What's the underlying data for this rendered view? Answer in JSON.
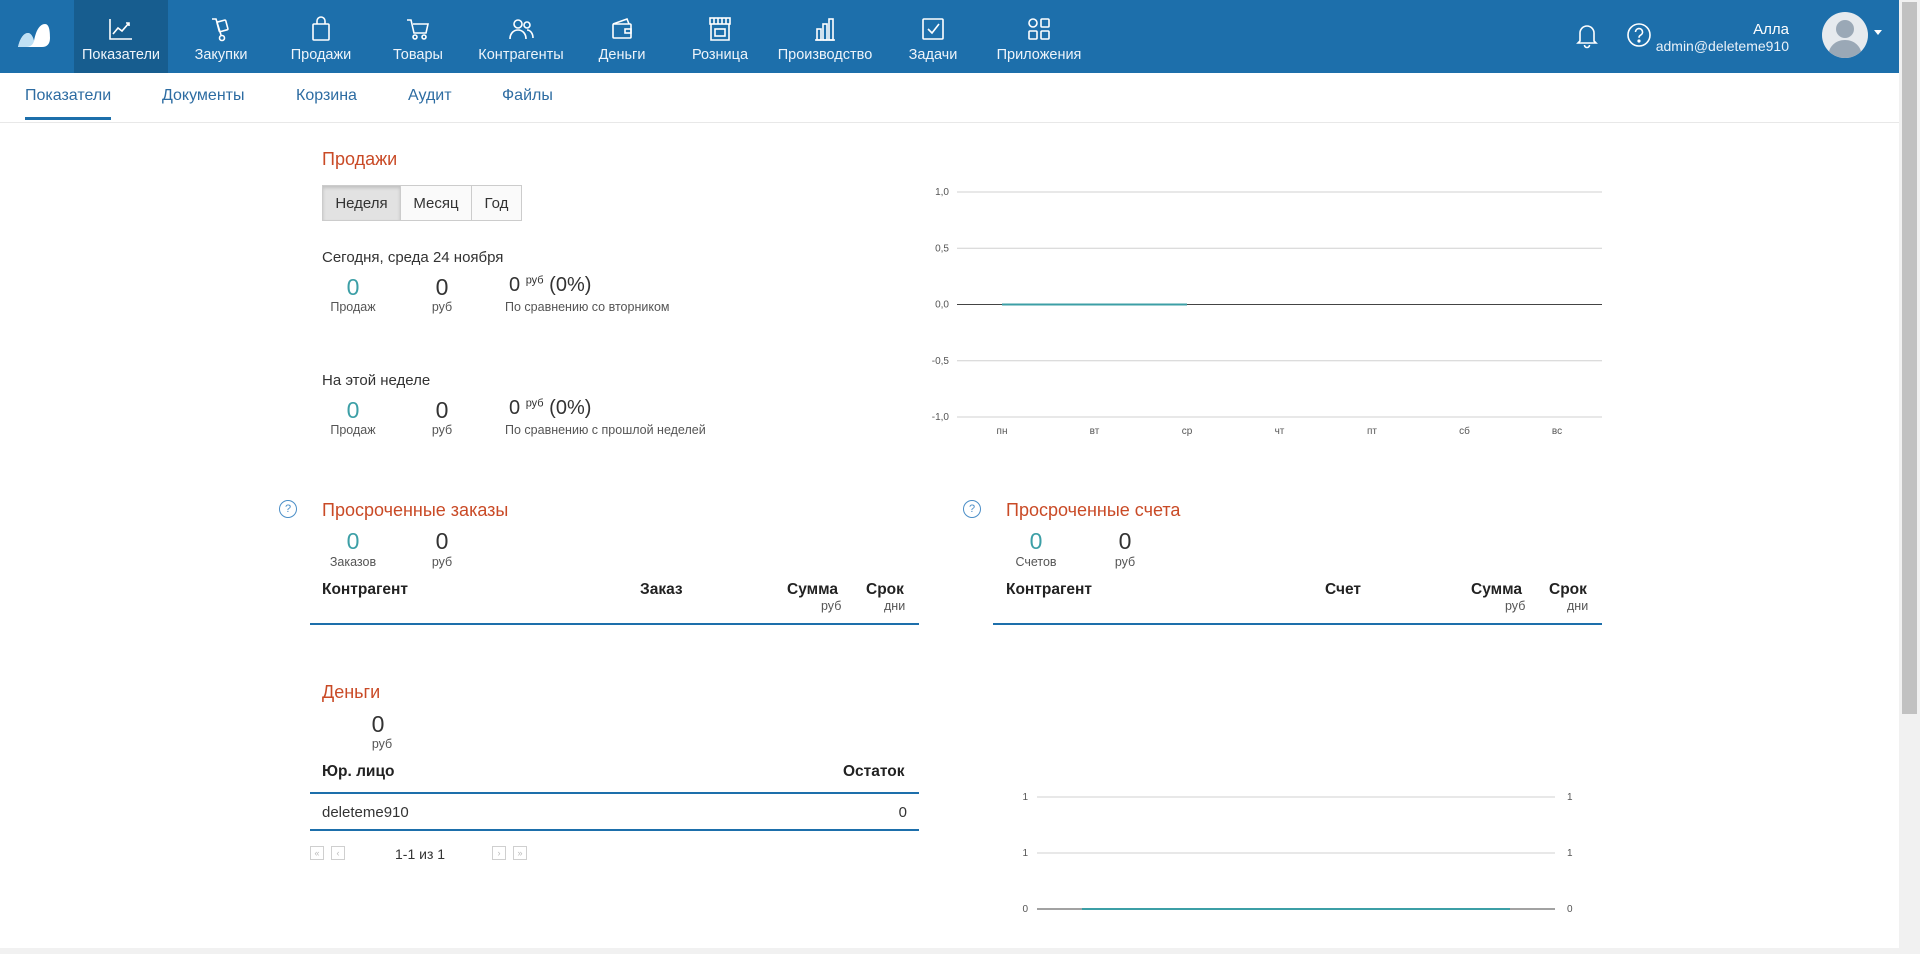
{
  "colors": {
    "nav_bg": "#1d6fab",
    "accent_title": "#c94a26",
    "teal": "#3c9fa6"
  },
  "topnav": {
    "items": [
      {
        "label": "Показатели",
        "icon": "chart-line-icon",
        "active": true
      },
      {
        "label": "Закупки",
        "icon": "hand-truck-icon"
      },
      {
        "label": "Продажи",
        "icon": "shopping-bag-icon"
      },
      {
        "label": "Товары",
        "icon": "cart-icon"
      },
      {
        "label": "Контрагенты",
        "icon": "users-icon"
      },
      {
        "label": "Деньги",
        "icon": "wallet-icon"
      },
      {
        "label": "Розница",
        "icon": "store-icon"
      },
      {
        "label": "Производство",
        "icon": "factory-icon"
      },
      {
        "label": "Задачи",
        "icon": "checkbox-icon"
      },
      {
        "label": "Приложения",
        "icon": "apps-grid-icon"
      }
    ],
    "user": {
      "name": "Алла",
      "email": "admin@deleteme910"
    }
  },
  "subnav": {
    "tabs": [
      {
        "label": "Показатели",
        "active": true
      },
      {
        "label": "Документы"
      },
      {
        "label": "Корзина"
      },
      {
        "label": "Аудит"
      },
      {
        "label": "Файлы"
      }
    ]
  },
  "sales": {
    "title": "Продажи",
    "periods": [
      "Неделя",
      "Месяц",
      "Год"
    ],
    "active_period": "Неделя",
    "today": {
      "label": "Сегодня, среда 24 ноября",
      "count": "0",
      "count_caption": "Продаж",
      "sum": "0",
      "sum_caption": "руб",
      "compare_value": "0",
      "compare_unit": "руб",
      "compare_pct": "(0%)",
      "compare_caption": "По сравнению со вторником"
    },
    "week": {
      "label": "На этой неделе",
      "count": "0",
      "count_caption": "Продаж",
      "sum": "0",
      "sum_caption": "руб",
      "compare_value": "0",
      "compare_unit": "руб",
      "compare_pct": "(0%)",
      "compare_caption": "По сравнению с прошлой неделей"
    }
  },
  "chart_data": [
    {
      "type": "line",
      "categories": [
        "пн",
        "вт",
        "ср",
        "чт",
        "пт",
        "сб",
        "вс"
      ],
      "series": [
        {
          "values": [
            0,
            0,
            0,
            null,
            null,
            null,
            null
          ]
        }
      ],
      "y_ticks": [
        "1,0",
        "0,5",
        "0,0",
        "-0,5",
        "-1,0"
      ],
      "ylim": [
        -1.0,
        1.0
      ],
      "grid": true
    },
    {
      "type": "line",
      "y_ticks_left": [
        "1",
        "1",
        "0"
      ],
      "y_ticks_right": [
        "1",
        "1",
        "0"
      ],
      "series": [
        {
          "values": [
            0,
            0
          ]
        }
      ],
      "grid": true
    }
  ],
  "overdue_orders": {
    "title": "Просроченные заказы",
    "count": "0",
    "count_caption": "Заказов",
    "sum": "0",
    "sum_caption": "руб",
    "columns": {
      "counterparty": "Контрагент",
      "doc": "Заказ",
      "sum": "Сумма",
      "sum_unit": "руб",
      "term": "Срок",
      "term_unit": "дни"
    }
  },
  "overdue_invoices": {
    "title": "Просроченные счета",
    "count": "0",
    "count_caption": "Счетов",
    "sum": "0",
    "sum_caption": "руб",
    "columns": {
      "counterparty": "Контрагент",
      "doc": "Счет",
      "sum": "Сумма",
      "sum_unit": "руб",
      "term": "Срок",
      "term_unit": "дни"
    }
  },
  "money": {
    "title": "Деньги",
    "total": "0",
    "total_caption": "руб",
    "columns": {
      "entity": "Юр. лицо",
      "balance": "Остаток"
    },
    "rows": [
      {
        "entity": "deleteme910",
        "balance": "0"
      }
    ],
    "pager": "1-1 из 1"
  }
}
